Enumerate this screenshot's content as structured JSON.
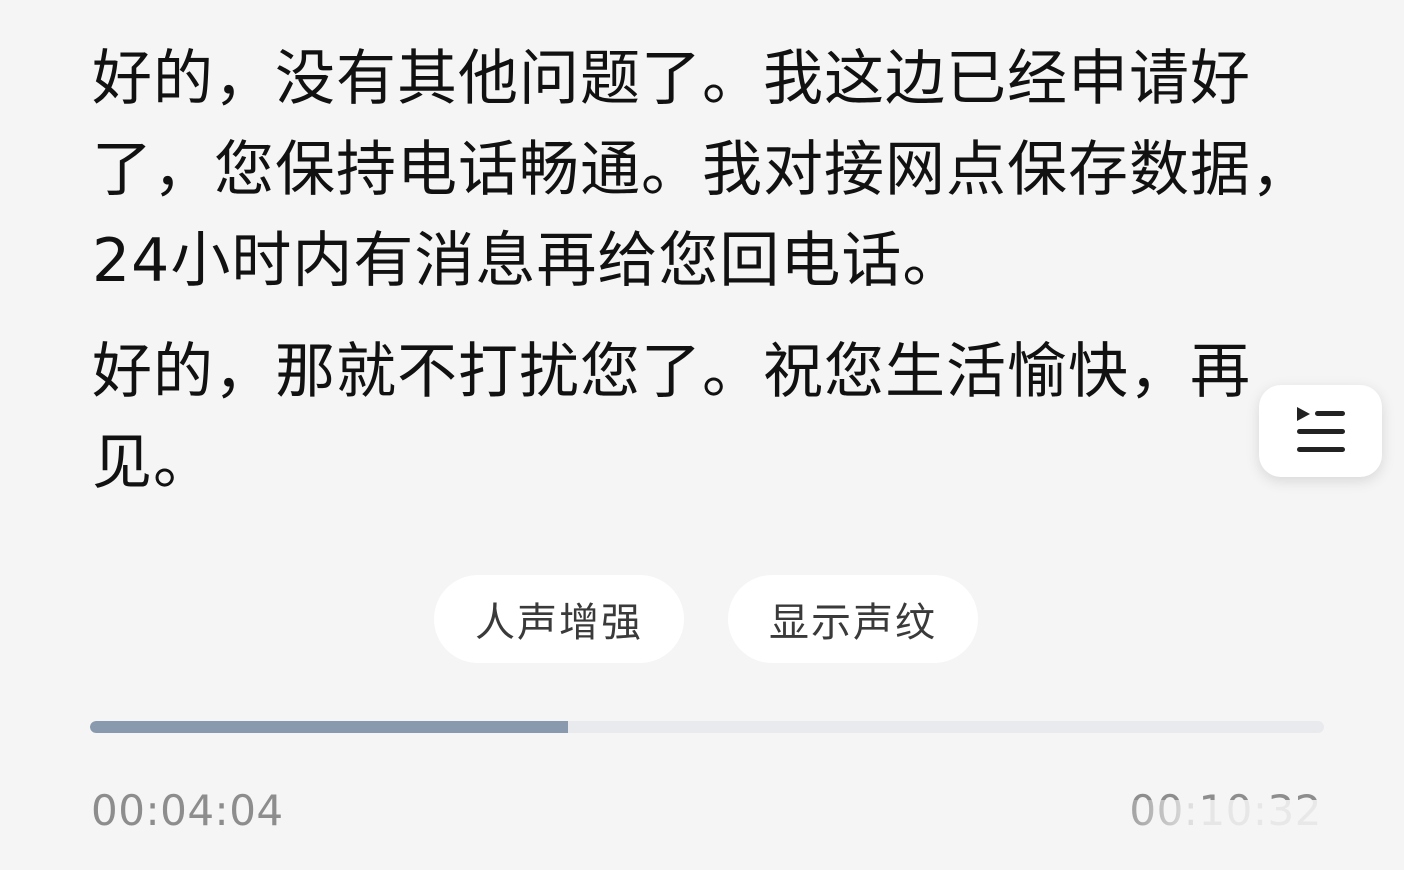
{
  "transcript": {
    "paragraphs": [
      "好的，没有其他问题了。我这边已经申请好了，您保持电话畅通。我对接网点保存数据，24小时内有消息再给您回电话。",
      "好的，那就不打扰您了。祝您生活愉快，再见。"
    ]
  },
  "float_button": {
    "icon": "playlist-icon"
  },
  "chips": [
    {
      "label": "人声增强"
    },
    {
      "label": "显示声纹"
    }
  ],
  "player": {
    "current_time": "00:04:04",
    "total_time": "00:10:32",
    "progress_fraction": 0.387
  },
  "colors": {
    "background": "#f5f5f5",
    "progress_fill": "#8a9aae",
    "progress_track": "#e9eaee",
    "chip_bg": "#ffffff"
  }
}
